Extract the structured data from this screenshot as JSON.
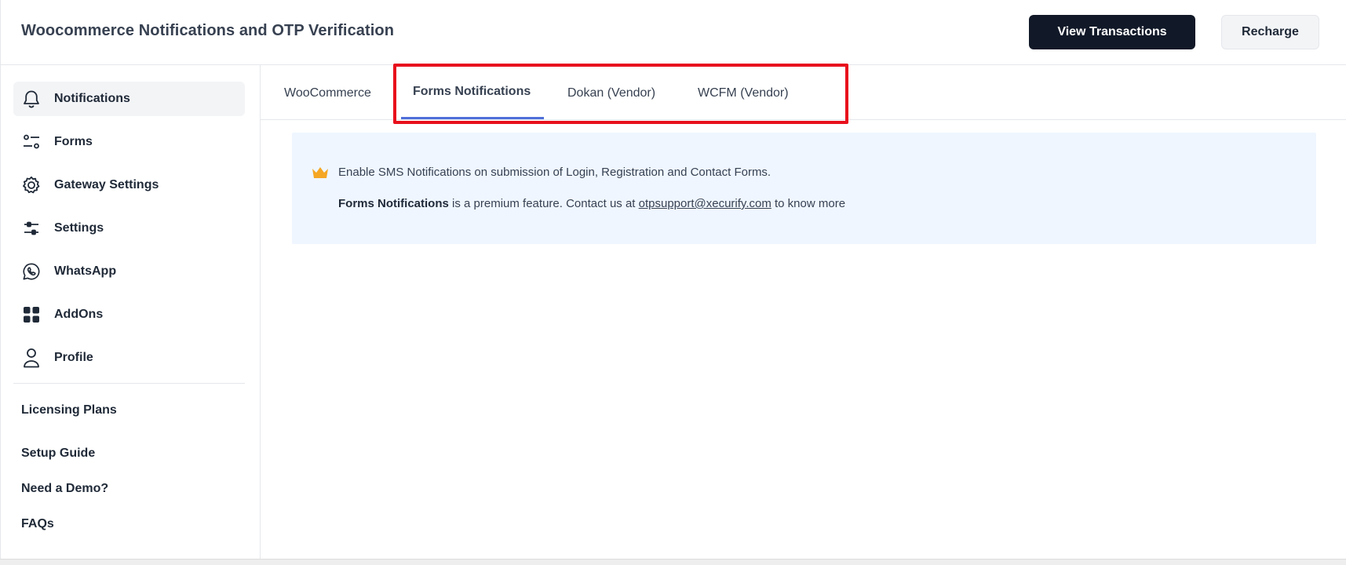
{
  "header": {
    "title": "Woocommerce Notifications and OTP Verification",
    "view_transactions_label": "View Transactions",
    "recharge_label": "Recharge"
  },
  "sidebar": {
    "items": [
      {
        "label": "Notifications",
        "icon": "bell-icon",
        "active": true
      },
      {
        "label": "Forms",
        "icon": "forms-icon"
      },
      {
        "label": "Gateway Settings",
        "icon": "gear-icon"
      },
      {
        "label": "Settings",
        "icon": "sliders-icon"
      },
      {
        "label": "WhatsApp",
        "icon": "whatsapp-icon"
      },
      {
        "label": "AddOns",
        "icon": "grid-icon"
      },
      {
        "label": "Profile",
        "icon": "user-icon"
      }
    ],
    "links": [
      {
        "label": "Licensing Plans"
      },
      {
        "label": "Setup Guide"
      },
      {
        "label": "Need a Demo?"
      },
      {
        "label": "FAQs"
      }
    ]
  },
  "tabs": [
    {
      "label": "WooCommerce"
    },
    {
      "label": "Forms Notifications",
      "active": true
    },
    {
      "label": "Dokan (Vendor)"
    },
    {
      "label": "WCFM (Vendor)"
    }
  ],
  "notice": {
    "line1": "Enable SMS Notifications on submission of Login, Registration and Contact Forms.",
    "feature_name": "Forms Notifications",
    "line2_middle": " is a premium feature. Contact us at ",
    "email": "otpsupport@xecurify.com",
    "line2_end": " to know more"
  },
  "colors": {
    "primary_button": "#111827",
    "tab_underline": "#4f6fd8",
    "highlight": "#e8101c",
    "notice_bg": "#eff6ff",
    "crown": "#f5a623"
  }
}
